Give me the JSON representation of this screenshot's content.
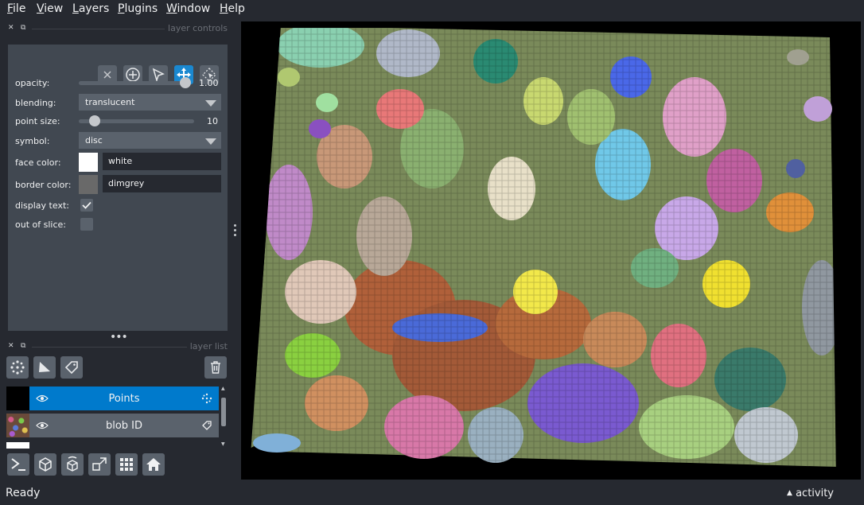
{
  "menu": [
    "File",
    "View",
    "Layers",
    "Plugins",
    "Window",
    "Help"
  ],
  "layer_controls": {
    "title": "layer controls",
    "opacity_label": "opacity:",
    "opacity_value": "1.00",
    "blending_label": "blending:",
    "blending_value": "translucent",
    "point_size_label": "point size:",
    "point_size_value": "10",
    "symbol_label": "symbol:",
    "symbol_value": "disc",
    "face_color_label": "face color:",
    "face_color_value": "white",
    "face_color_hex": "#ffffff",
    "border_color_label": "border color:",
    "border_color_value": "dimgrey",
    "border_color_hex": "#696969",
    "display_text_label": "display text:",
    "display_text_checked": true,
    "out_of_slice_label": "out of slice:",
    "out_of_slice_checked": false,
    "tools": [
      "delete-selected",
      "add-points",
      "select-points",
      "pan-zoom",
      "transform"
    ],
    "active_tool": "pan-zoom"
  },
  "layer_list": {
    "title": "layer list",
    "layers": [
      {
        "name": "Points",
        "visible": true,
        "selected": true,
        "type_icon": "points-icon"
      },
      {
        "name": "blob ID",
        "visible": true,
        "selected": false,
        "type_icon": "label-icon"
      }
    ]
  },
  "status": {
    "text": "Ready",
    "activity": "activity"
  },
  "colors": {
    "accent": "#007acc",
    "panel": "#414851",
    "background": "#262930"
  }
}
